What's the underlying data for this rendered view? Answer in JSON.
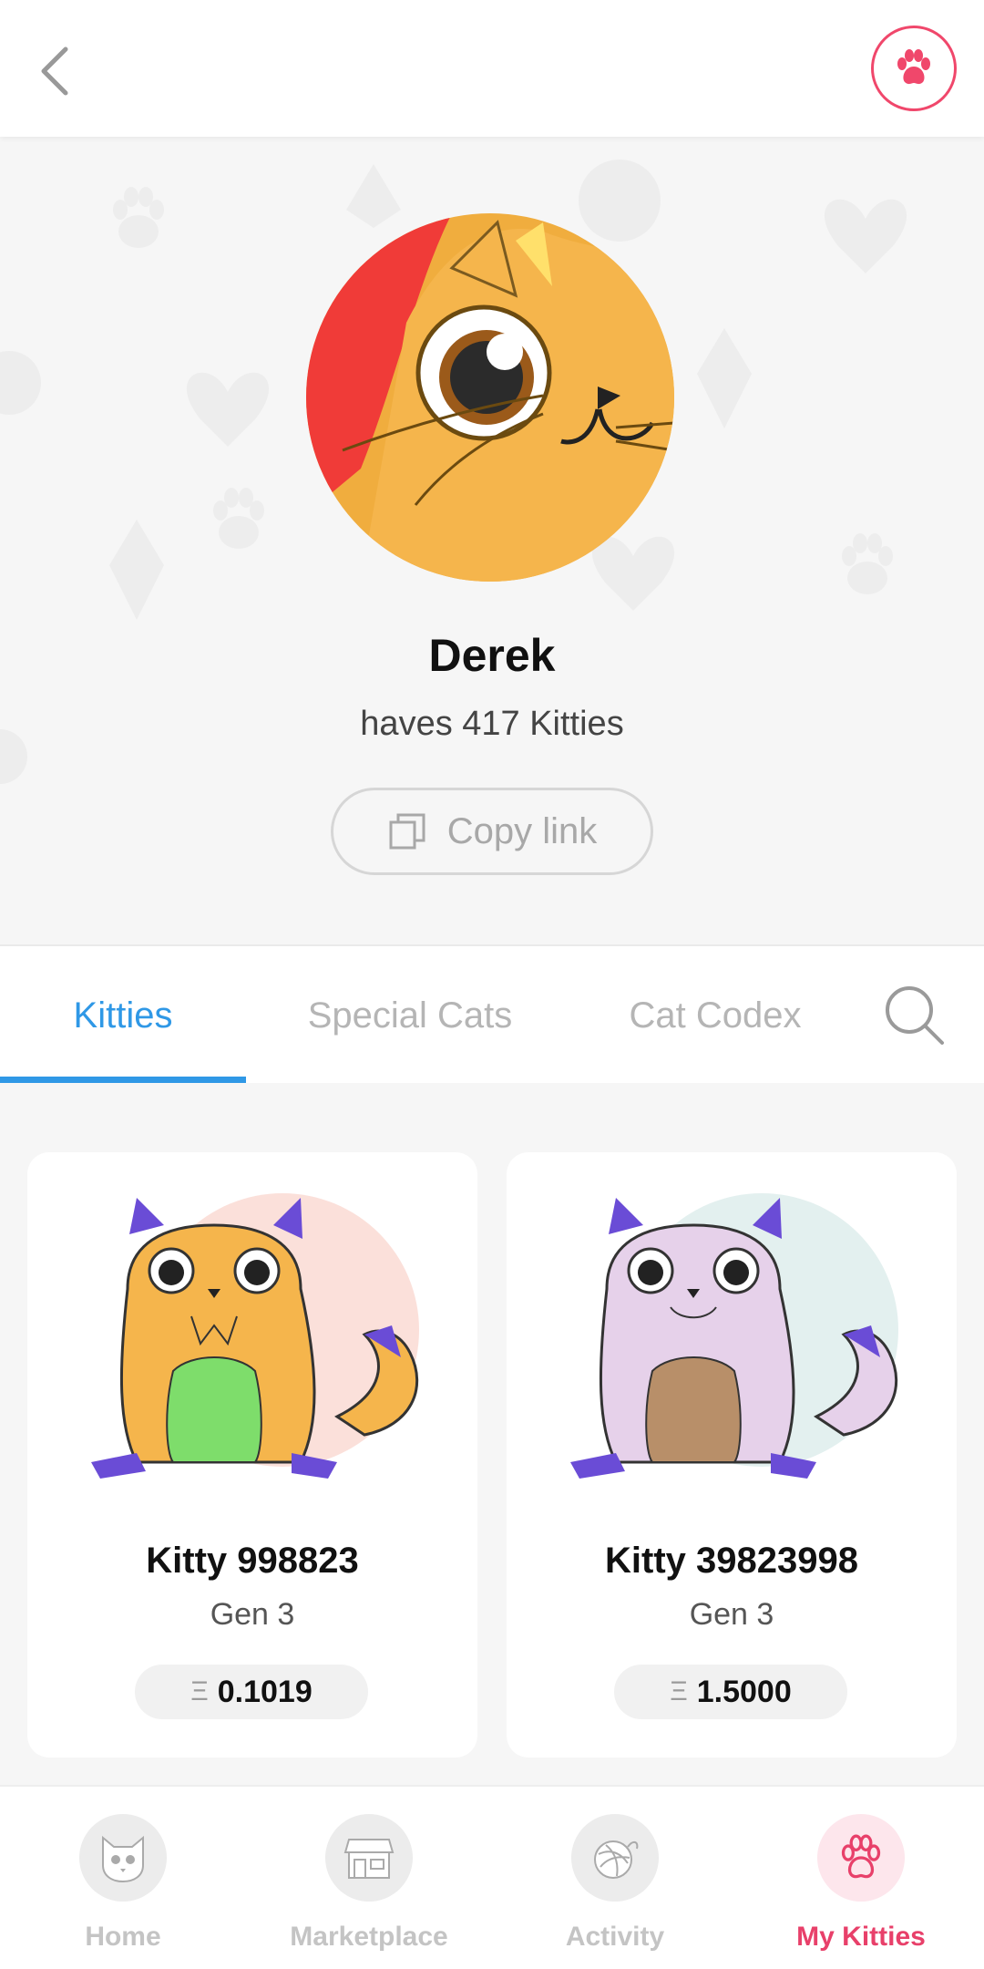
{
  "colors": {
    "accent_blue": "#2f98e6",
    "accent_pink": "#e8406a",
    "muted": "#b5b5b5"
  },
  "header": {
    "back_icon": "chevron-left-icon",
    "profile_icon": "paw-icon"
  },
  "profile": {
    "name": "Derek",
    "subtitle": "haves 417 Kitties",
    "copy_link_label": "Copy link",
    "copy_icon": "copy-icon"
  },
  "tabs": {
    "items": [
      {
        "label": "Kitties",
        "active": true
      },
      {
        "label": "Special Cats",
        "active": false
      },
      {
        "label": "Cat Codex",
        "active": false
      }
    ],
    "search_icon": "search-icon"
  },
  "kitties": [
    {
      "name": "Kitty 998823",
      "generation": "Gen 3",
      "price_symbol": "Ξ",
      "price": "0.1019",
      "body_color": "#f5b54c",
      "belly_color": "#7edd6b",
      "bg_circle": "#fbe0da"
    },
    {
      "name": "Kitty 39823998",
      "generation": "Gen 3",
      "price_symbol": "Ξ",
      "price": "1.5000",
      "body_color": "#e6d1ea",
      "belly_color": "#b88f69",
      "bg_circle": "#e3f0ef"
    }
  ],
  "bottom_nav": [
    {
      "label": "Home",
      "icon": "cat-face-icon",
      "active": false
    },
    {
      "label": "Marketplace",
      "icon": "store-icon",
      "active": false
    },
    {
      "label": "Activity",
      "icon": "yarn-ball-icon",
      "active": false
    },
    {
      "label": "My Kitties",
      "icon": "paw-icon",
      "active": true
    }
  ]
}
